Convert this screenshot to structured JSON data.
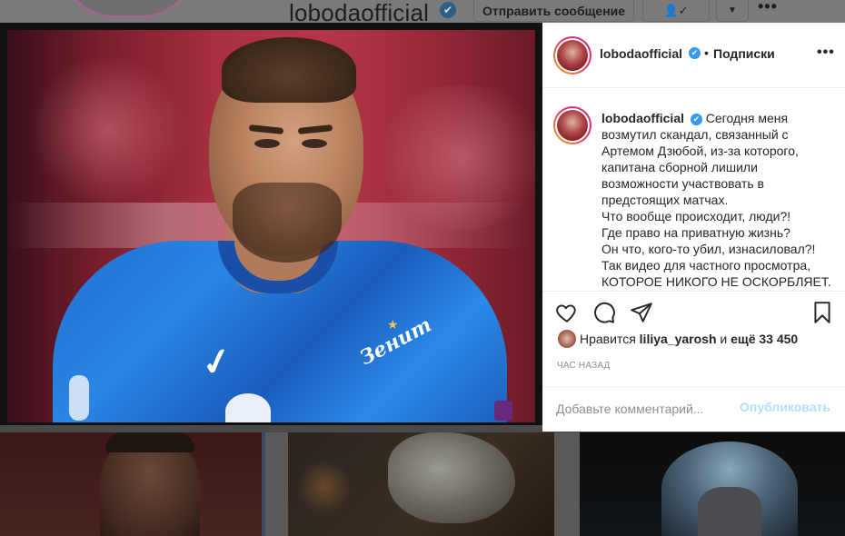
{
  "background_profile": {
    "username": "lobodaofficial",
    "message_button": "Отправить сообщение"
  },
  "post": {
    "username": "lobodaofficial",
    "follow_status": "Подписки",
    "caption_lines": [
      "Сегодня меня",
      "возмутил скандал, связанный с",
      "Артемом Дзюбой, из-за которого,",
      "капитана сборной лишили",
      "возможности участвовать в",
      "предстоящих матчах.",
      "Что вообще происходит, люди?!",
      "Где право на приватную жизнь?",
      "Он что, кого-то убил, изнасиловал?!",
      "Так видео для частного просмотра,",
      "КОТОРОЕ НИКОГО НЕ ОСКОРБЛЯЕТ."
    ],
    "likes": {
      "prefix": "Нравится",
      "user": "liliya_yarosh",
      "connector": "и",
      "count": "ещё 33 450"
    },
    "timestamp": "ЧАС НАЗАД",
    "comment_placeholder": "Добавьте комментарий...",
    "publish_label": "Опубликовать"
  },
  "colors": {
    "verified": "#3897f0",
    "publish_disabled": "#b2dffc",
    "story_ring_start": "#f5a623",
    "story_ring_end": "#c13584"
  }
}
